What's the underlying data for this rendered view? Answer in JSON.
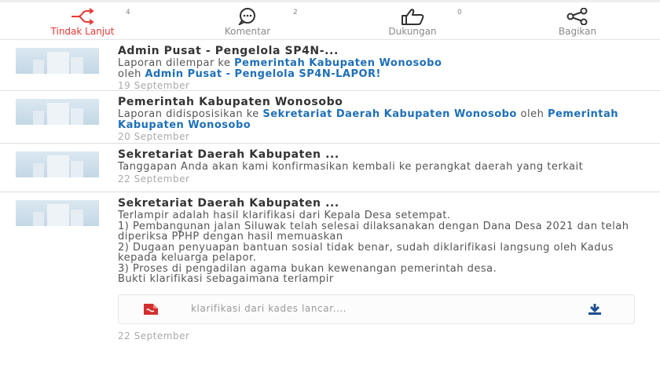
{
  "actions": [
    {
      "label": "Tindak Lanjut",
      "count": "4",
      "icon": "share-forward-icon"
    },
    {
      "label": "Komentar",
      "count": "2",
      "icon": "comment-bubble-icon"
    },
    {
      "label": "Dukungan",
      "count": "0",
      "icon": "thumbs-up-icon"
    },
    {
      "label": "Bagikan",
      "count": "",
      "icon": "share-icon"
    }
  ],
  "accent_color": "#e53935",
  "link_color": "#1e6fb8",
  "items": [
    {
      "title": "Admin Pusat - Pengelola SP4N-...",
      "text_prefix": "Laporan dilempar ke ",
      "link1": "Pemerintah Kabupaten Wonosobo",
      "text_mid": "oleh ",
      "link2": "Admin Pusat - Pengelola SP4N-LAPOR!",
      "date": "19 September"
    },
    {
      "title": "Pemerintah Kabupaten Wonosobo",
      "text_prefix": "Laporan didisposisikan ke ",
      "link1": "Sekretariat Daerah Kabupaten Wonosobo",
      "text_mid": " oleh ",
      "link2": "Pemerintah Kabupaten Wonosobo",
      "date": "20 September"
    },
    {
      "title": "Sekretariat Daerah Kabupaten ...",
      "text": "Tanggapan Anda akan kami konfirmasikan kembali ke perangkat daerah yang terkait",
      "date": "22 September"
    },
    {
      "title": "Sekretariat Daerah Kabupaten ...",
      "lines": [
        "Terlampir adalah hasil klarifikasi dari Kepala Desa setempat.",
        "1) Pembangunan jalan Siluwak telah selesai dilaksanakan dengan Dana Desa 2021 dan telah diperiksa PPHP dengan hasil memuaskan",
        "2) Dugaan penyuapan bantuan sosial tidak benar, sudah diklarifikasi langsung oleh Kadus kepada keluarga pelapor.",
        "3) Proses di pengadilan agama bukan kewenangan pemerintah desa.",
        "Bukti klarifikasi sebagaimana terlampir"
      ],
      "attachment": {
        "filename": "klarifikasi dari kades lancar....",
        "icon": "pdf-file-icon",
        "action_icon": "download-icon"
      },
      "date": "22 September"
    }
  ]
}
